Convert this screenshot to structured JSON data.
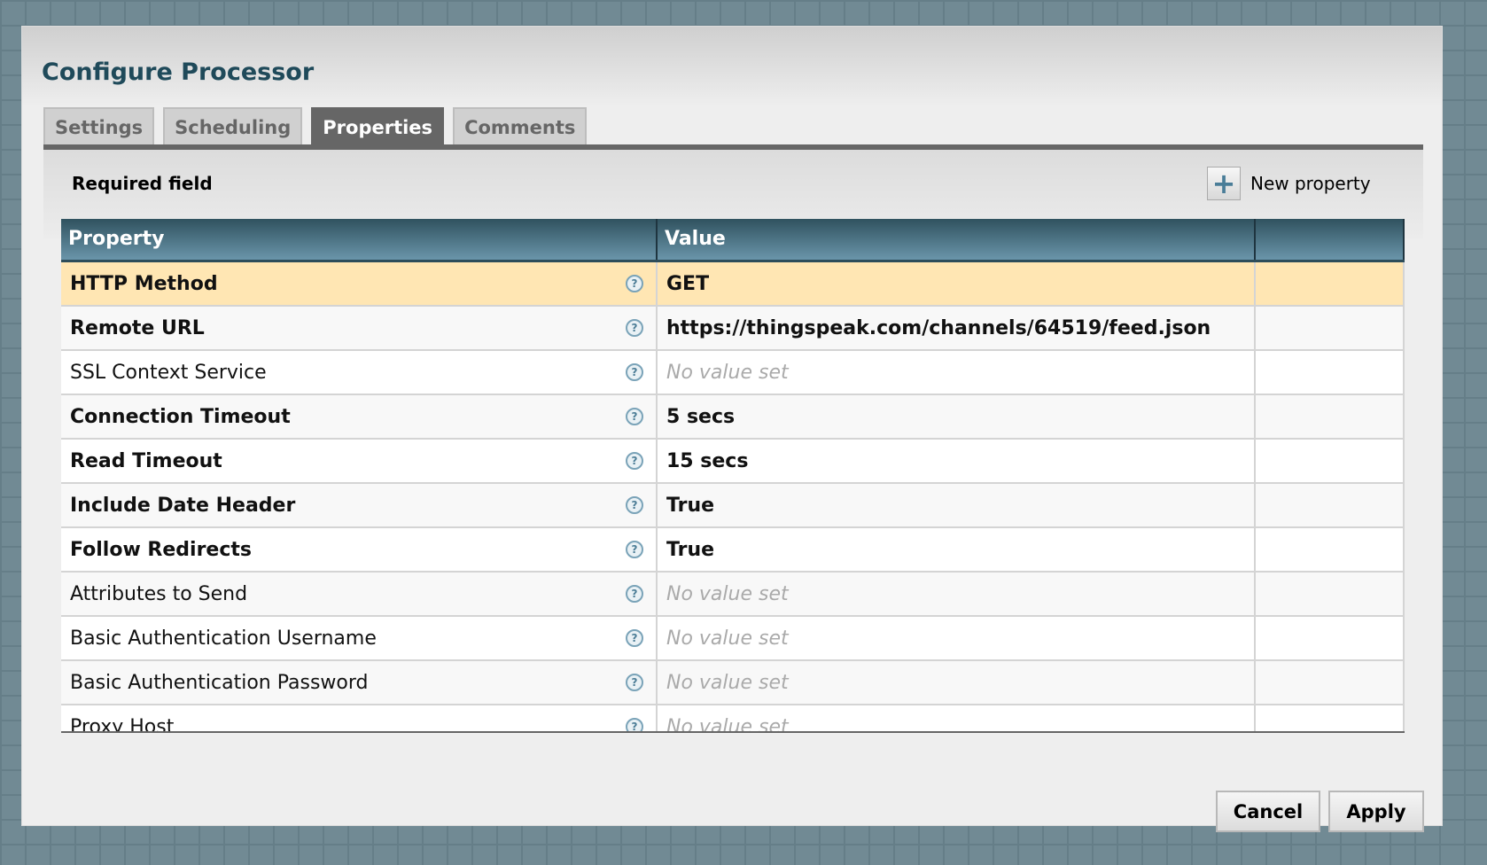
{
  "dialog": {
    "title": "Configure Processor"
  },
  "tabs": [
    {
      "label": "Settings"
    },
    {
      "label": "Scheduling"
    },
    {
      "label": "Properties",
      "active": true
    },
    {
      "label": "Comments"
    }
  ],
  "panel": {
    "required_label": "Required field",
    "new_property_label": "New property",
    "new_property_icon": "plus-icon"
  },
  "table": {
    "headers": [
      "Property",
      "Value",
      ""
    ],
    "rows": [
      {
        "name": "HTTP Method",
        "value": "GET",
        "required": true,
        "selected": true
      },
      {
        "name": "Remote URL",
        "value": "https://thingspeak.com/channels/64519/feed.json",
        "required": true
      },
      {
        "name": "SSL Context Service",
        "value": "No value set",
        "required": false,
        "empty": true
      },
      {
        "name": "Connection Timeout",
        "value": "5 secs",
        "required": true
      },
      {
        "name": "Read Timeout",
        "value": "15 secs",
        "required": true
      },
      {
        "name": "Include Date Header",
        "value": "True",
        "required": true
      },
      {
        "name": "Follow Redirects",
        "value": "True",
        "required": true
      },
      {
        "name": "Attributes to Send",
        "value": "No value set",
        "required": false,
        "empty": true
      },
      {
        "name": "Basic Authentication Username",
        "value": "No value set",
        "required": false,
        "empty": true
      },
      {
        "name": "Basic Authentication Password",
        "value": "No value set",
        "required": false,
        "empty": true
      },
      {
        "name": "Proxy Host",
        "value": "No value set",
        "required": false,
        "empty": true
      }
    ],
    "help_glyph": "?"
  },
  "buttons": {
    "cancel": "Cancel",
    "apply": "Apply"
  }
}
